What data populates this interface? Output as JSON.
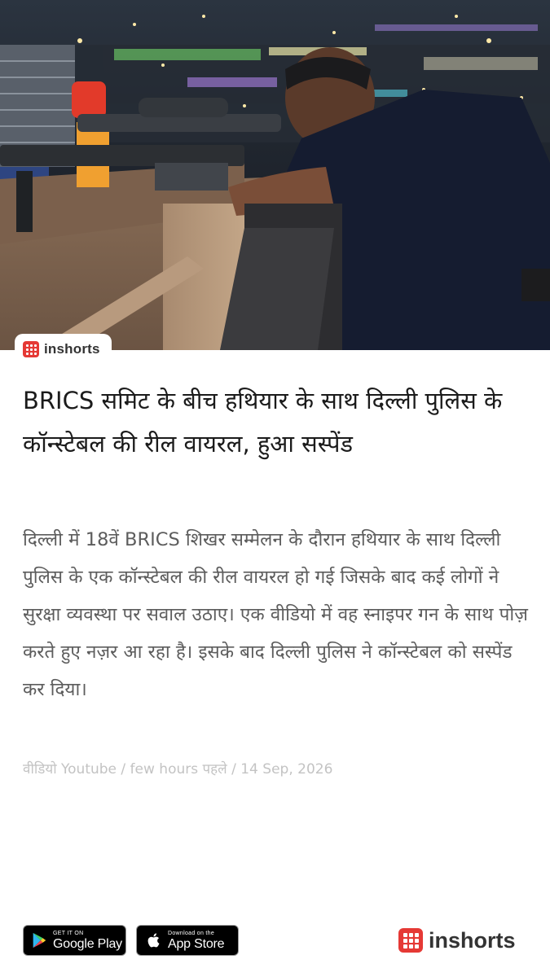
{
  "hero": {
    "icon": "news-photo-sniper-rooftop-night"
  },
  "brand": {
    "name": "inshorts",
    "color": "#e53935"
  },
  "article": {
    "headline": "BRICS समिट के बीच हथियार के साथ दिल्ली पुलिस के कॉन्स्टेबल की रील वायरल, हुआ सस्पेंड",
    "body": "दिल्ली में 18वें BRICS शिखर सम्मेलन के दौरान हथियार के साथ दिल्ली पुलिस के एक कॉन्स्टेबल की रील वायरल हो गई जिसके बाद कई लोगों ने सुरक्षा व्यवस्था पर सवाल उठाए। एक वीडियो में वह स्नाइपर गन के साथ पोज़ करते हुए नज़र आ रहा है। इसके बाद दिल्ली पुलिस ने कॉन्स्टेबल को सस्पेंड कर दिया।",
    "meta": "वीडियो Youtube / few hours पहले / 14 Sep, 2026"
  },
  "footer": {
    "google_play": {
      "small": "GET IT ON",
      "big": "Google Play",
      "icon": "google-play-icon"
    },
    "app_store": {
      "small": "Download on the",
      "big": "App Store",
      "icon": "apple-icon"
    },
    "brand_name": "inshorts"
  }
}
